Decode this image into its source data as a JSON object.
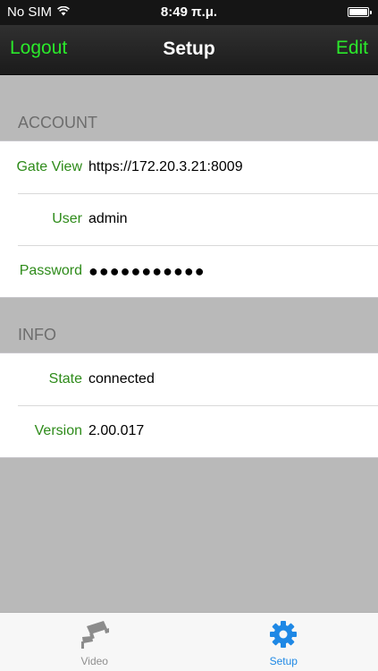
{
  "status_bar": {
    "carrier": "No SIM",
    "time": "8:49 π.μ."
  },
  "nav": {
    "left_button": "Logout",
    "title": "Setup",
    "right_button": "Edit"
  },
  "sections": {
    "account": {
      "header": "ACCOUNT",
      "rows": [
        {
          "label": "Gate View",
          "value": "https://172.20.3.21:8009"
        },
        {
          "label": "User",
          "value": "admin"
        },
        {
          "label": "Password",
          "value": "●●●●●●●●●●●"
        }
      ]
    },
    "info": {
      "header": "INFO",
      "rows": [
        {
          "label": "State",
          "value": "connected"
        },
        {
          "label": "Version",
          "value": "2.00.017"
        }
      ]
    }
  },
  "tab_bar": {
    "tabs": [
      {
        "label": "Video",
        "icon": "camera-icon",
        "active": false
      },
      {
        "label": "Setup",
        "icon": "gear-icon",
        "active": true
      }
    ]
  },
  "colors": {
    "accent_nav": "#2be82b",
    "label_green": "#2e8b1a",
    "tab_active": "#1e88e5",
    "background": "#b9b9b9"
  }
}
